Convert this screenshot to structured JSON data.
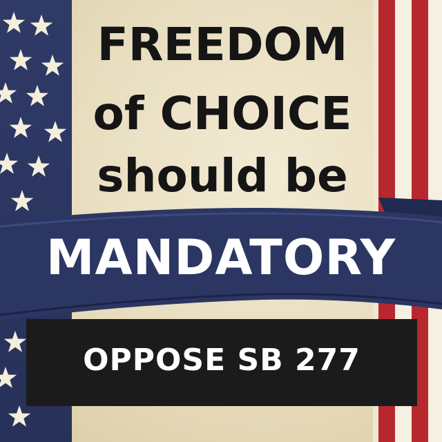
{
  "headline": {
    "line1": "FREEDOM",
    "line2": "of CHOICE",
    "line3": "should be"
  },
  "banner": {
    "text": "MANDATORY"
  },
  "callout": {
    "text": "OPPOSE SB 277"
  },
  "colors": {
    "navy": "#2b3662",
    "red": "#b7282e",
    "parchment": "#ece2c8",
    "ink": "#151515",
    "callout_bg": "#1b1b1b",
    "white": "#ffffff"
  },
  "icons": [
    "star-icon"
  ]
}
